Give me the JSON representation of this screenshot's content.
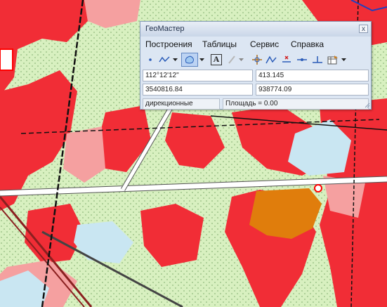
{
  "window": {
    "title": "ГеоМастер",
    "close_glyph": "x"
  },
  "menu": {
    "items": [
      "Построения",
      "Таблицы",
      "Сервис",
      "Справка"
    ]
  },
  "toolbar": {
    "tools": [
      "point-icon",
      "polyline-icon",
      "dropdown-arrow-icon",
      "area-icon",
      "dropdown-arrow-icon",
      "text-icon",
      "pen-icon",
      "target-icon",
      "vertex-icon",
      "snap-icon",
      "line-point-icon",
      "perpendicular-icon",
      "table-icon",
      "dropdown-arrow-icon"
    ],
    "text_tool_glyph": "A"
  },
  "fields": {
    "longitude": "112°12'12\"",
    "value_1": "413.145",
    "x_coordinate": "3540816.84",
    "y_coordinate": "938774.09"
  },
  "status": {
    "mode": "дирекционные",
    "area": "Площадь = 0.00"
  },
  "colors": {
    "map_background": "#d8f0c0",
    "red_zone": "#f12d36",
    "pink_zone": "#f5a0a0",
    "light_blue_zone": "#c9e6f2",
    "orange_zone": "#e07d0c",
    "window_background": "#dce6f3"
  }
}
